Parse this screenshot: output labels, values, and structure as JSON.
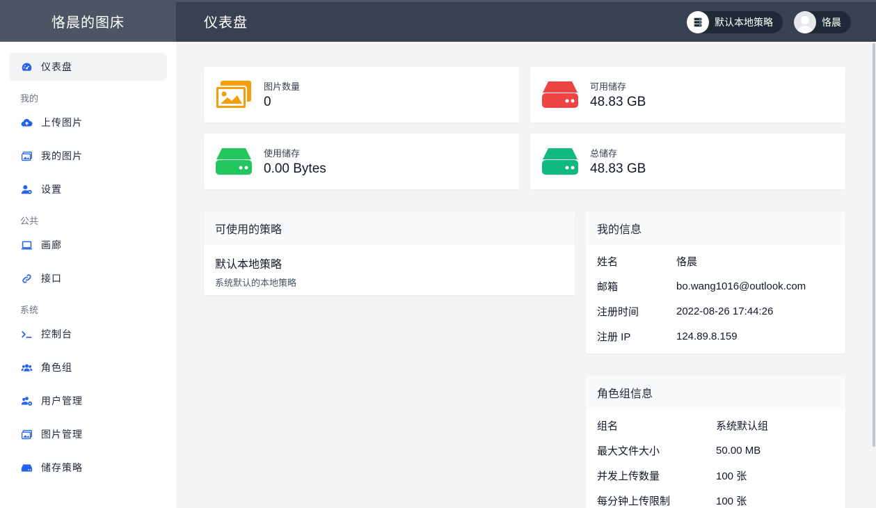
{
  "brand": {
    "title": "恪晨的图床"
  },
  "header": {
    "title": "仪表盘",
    "strategy_label": "默认本地策略",
    "user_name": "恪晨"
  },
  "sidebar": {
    "dashboard": "仪表盘",
    "groups": {
      "mine": "我的",
      "public": "公共",
      "system": "系统"
    },
    "items": {
      "upload": "上传图片",
      "my_images": "我的图片",
      "settings": "设置",
      "gallery": "画廊",
      "api": "接口",
      "console": "控制台",
      "roles": "角色组",
      "users": "用户管理",
      "images": "图片管理",
      "storage": "储存策略"
    }
  },
  "stats": {
    "image_count": {
      "label": "图片数量",
      "value": "0"
    },
    "available_storage": {
      "label": "可用储存",
      "value": "48.83 GB"
    },
    "used_storage": {
      "label": "使用储存",
      "value": "0.00 Bytes"
    },
    "total_storage": {
      "label": "总储存",
      "value": "48.83 GB"
    }
  },
  "policies": {
    "title": "可使用的策略",
    "items": [
      {
        "name": "默认本地策略",
        "desc": "系统默认的本地策略"
      }
    ]
  },
  "my_info": {
    "title": "我的信息",
    "rows": [
      {
        "k": "姓名",
        "v": "恪晨"
      },
      {
        "k": "邮箱",
        "v": "bo.wang1016@outlook.com"
      },
      {
        "k": "注册时间",
        "v": "2022-08-26 17:44:26"
      },
      {
        "k": "注册 IP",
        "v": "124.89.8.159"
      }
    ]
  },
  "role_info": {
    "title": "角色组信息",
    "rows": [
      {
        "k": "组名",
        "v": "系统默认组"
      },
      {
        "k": "最大文件大小",
        "v": "50.00 MB"
      },
      {
        "k": "并发上传数量",
        "v": "100 张"
      },
      {
        "k": "每分钟上传限制",
        "v": "100 张"
      }
    ]
  },
  "colors": {
    "header": "#374151",
    "brand": "#4b5563",
    "nav_icon": "#2563eb",
    "image_icon": "#f59e0b",
    "red_drive": "#ef4444",
    "green_drive": "#22c55e",
    "teal_drive": "#10b981"
  }
}
